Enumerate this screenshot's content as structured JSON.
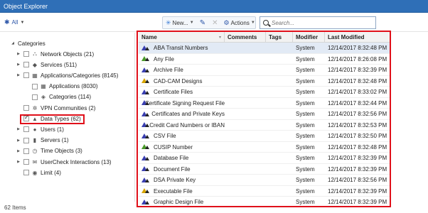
{
  "window": {
    "title": "Object Explorer"
  },
  "toolbar": {
    "all_label": "All",
    "new_label": "New...",
    "actions_label": "Actions",
    "search_placeholder": "Search..."
  },
  "tree": {
    "root_label": "Categories",
    "items": [
      {
        "label": "Network Objects (21)",
        "icon": "network-icon",
        "indent": 1,
        "twisty": true,
        "checked": false
      },
      {
        "label": "Services (511)",
        "icon": "services-icon",
        "indent": 1,
        "twisty": true,
        "checked": false
      },
      {
        "label": "Applications/Categories (8145)",
        "icon": "applications-icon",
        "indent": 1,
        "twisty": true,
        "checked": false
      },
      {
        "label": "Applications (8030)",
        "icon": "application-icon",
        "indent": 2,
        "twisty": false,
        "checked": false
      },
      {
        "label": "Categories (114)",
        "icon": "tag-icon",
        "indent": 2,
        "twisty": false,
        "checked": false
      },
      {
        "label": "VPN Communities (2)",
        "icon": "vpn-icon",
        "indent": 1,
        "twisty": false,
        "checked": false
      },
      {
        "label": "Data Types (62)",
        "icon": "data-type-icon",
        "indent": 1,
        "twisty": false,
        "checked": true
      },
      {
        "label": "Users (1)",
        "icon": "user-icon",
        "indent": 1,
        "twisty": true,
        "checked": false
      },
      {
        "label": "Servers (1)",
        "icon": "server-icon",
        "indent": 1,
        "twisty": true,
        "checked": false
      },
      {
        "label": "Time Objects (3)",
        "icon": "clock-icon",
        "indent": 1,
        "twisty": true,
        "checked": false
      },
      {
        "label": "UserCheck Interactions (13)",
        "icon": "usercheck-icon",
        "indent": 1,
        "twisty": true,
        "checked": false
      },
      {
        "label": "Limit (4)",
        "icon": "limit-icon",
        "indent": 1,
        "twisty": false,
        "checked": false
      }
    ]
  },
  "status": {
    "count_label": "62 Items"
  },
  "grid": {
    "columns": [
      "Name",
      "Comments",
      "Tags",
      "Modifier",
      "Last Modified"
    ],
    "rows": [
      {
        "name": "ABA Transit Numbers",
        "modifier": "System",
        "modified": "12/14/2017 8:32:48 PM",
        "color": "blue"
      },
      {
        "name": "Any File",
        "modifier": "System",
        "modified": "12/14/2017 8:26:08 PM",
        "color": "green"
      },
      {
        "name": "Archive File",
        "modifier": "System",
        "modified": "12/14/2017 8:32:39 PM",
        "color": "blue"
      },
      {
        "name": "CAD-CAM Designs",
        "modifier": "System",
        "modified": "12/14/2017 8:32:48 PM",
        "color": "yellow"
      },
      {
        "name": "Certificate Files",
        "modifier": "System",
        "modified": "12/14/2017 8:33:02 PM",
        "color": "blue"
      },
      {
        "name": "Certificate Signing Request File",
        "modifier": "System",
        "modified": "12/14/2017 8:32:44 PM",
        "color": "blue"
      },
      {
        "name": "Certificates and Private Keys",
        "modifier": "System",
        "modified": "12/14/2017 8:32:56 PM",
        "color": "blue"
      },
      {
        "name": "Credit Card Numbers or IBAN",
        "modifier": "System",
        "modified": "12/14/2017 8:32:53 PM",
        "color": "blue"
      },
      {
        "name": "CSV File",
        "modifier": "System",
        "modified": "12/14/2017 8:32:50 PM",
        "color": "blue"
      },
      {
        "name": "CUSIP Number",
        "modifier": "System",
        "modified": "12/14/2017 8:32:48 PM",
        "color": "green"
      },
      {
        "name": "Database File",
        "modifier": "System",
        "modified": "12/14/2017 8:32:39 PM",
        "color": "blue"
      },
      {
        "name": "Document File",
        "modifier": "System",
        "modified": "12/14/2017 8:32:39 PM",
        "color": "blue"
      },
      {
        "name": "DSA Private Key",
        "modifier": "System",
        "modified": "12/14/2017 8:32:56 PM",
        "color": "blue"
      },
      {
        "name": "Executable File",
        "modifier": "System",
        "modified": "12/14/2017 8:32:39 PM",
        "color": "yellow"
      },
      {
        "name": "Graphic Design File",
        "modifier": "System",
        "modified": "12/14/2017 8:32:39 PM",
        "color": "blue"
      }
    ]
  },
  "colors": {
    "titlebar": "#2f6fb7",
    "highlight": "#e0101a",
    "selected_row": "#e2eaf5"
  }
}
